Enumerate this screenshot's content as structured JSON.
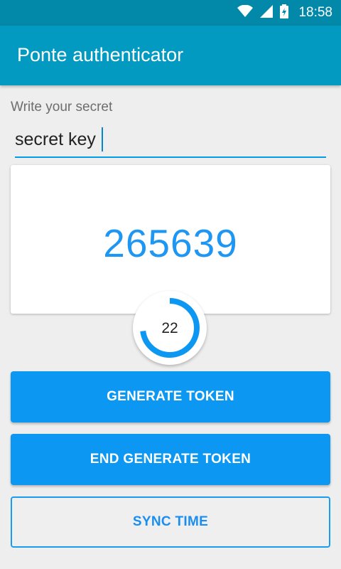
{
  "status_bar": {
    "time": "18:58",
    "icons": [
      "wifi-icon",
      "signal-icon",
      "battery-charging-icon"
    ]
  },
  "app_bar": {
    "title": "Ponte authenticator"
  },
  "secret": {
    "label": "Write your secret",
    "value": "secret key"
  },
  "token": {
    "value": "265639"
  },
  "timer": {
    "seconds": "22",
    "progress_fraction": 0.73
  },
  "buttons": {
    "generate": "GENERATE TOKEN",
    "end_generate": "END GENERATE TOKEN",
    "sync_time": "SYNC TIME"
  },
  "colors": {
    "status_bar": "#0288a8",
    "app_bar": "#029ac1",
    "accent": "#0c98f2",
    "token_text": "#1e96f3"
  }
}
